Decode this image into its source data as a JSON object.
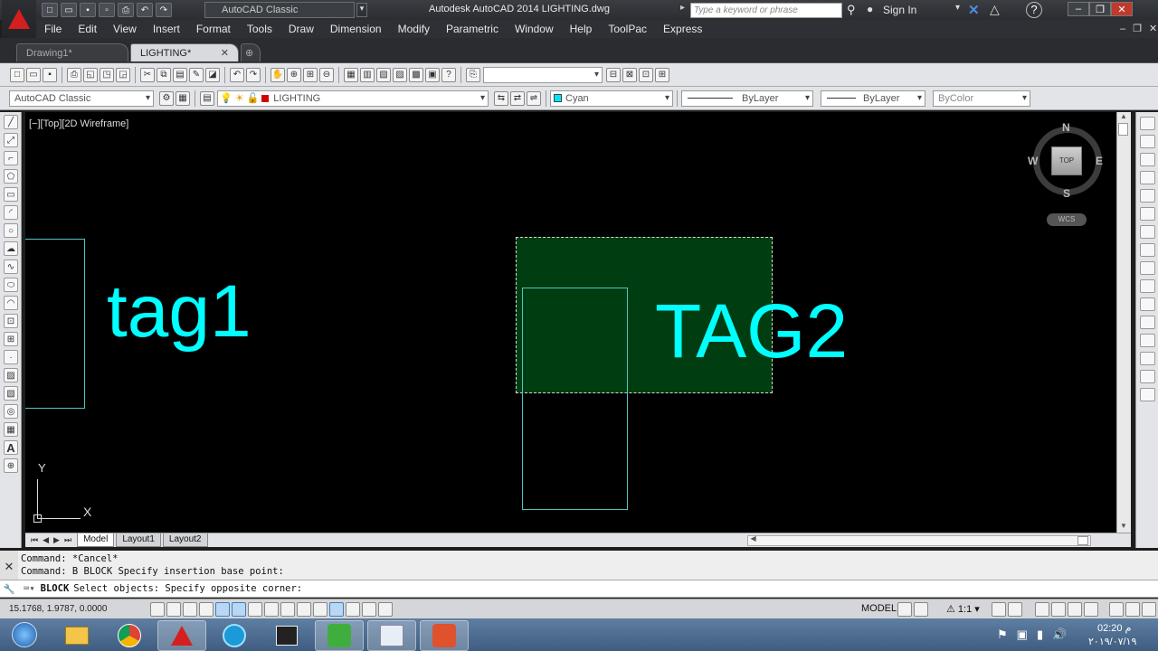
{
  "title_bar": {
    "workspace": "AutoCAD Classic",
    "app_title": "Autodesk AutoCAD 2014    LIGHTING.dwg",
    "search_placeholder": "Type a keyword or phrase",
    "sign_in": "Sign In"
  },
  "menu": {
    "items": [
      "File",
      "Edit",
      "View",
      "Insert",
      "Format",
      "Tools",
      "Draw",
      "Dimension",
      "Modify",
      "Parametric",
      "Window",
      "Help",
      "ToolPac",
      "Express"
    ]
  },
  "doc_tabs": [
    {
      "label": "Drawing1*",
      "active": false
    },
    {
      "label": "LIGHTING*",
      "active": true
    }
  ],
  "toolbar2": {
    "workspace_combo": "AutoCAD Classic",
    "layer_combo": "LIGHTING",
    "color_combo": "Cyan",
    "linetype_combo": "ByLayer",
    "lineweight_combo": "ByLayer",
    "plotstyle_combo": "ByColor"
  },
  "canvas": {
    "viewport_label": "[−][Top][2D Wireframe]",
    "text_objects": [
      "tag1",
      "TAG2"
    ],
    "viewcube": {
      "north": "N",
      "south": "S",
      "east": "E",
      "west": "W",
      "face": "TOP",
      "wcs": "WCS"
    },
    "ucs": {
      "x": "X",
      "y": "Y"
    },
    "entity_color": "#00ffff",
    "selection_fill": "#003d10"
  },
  "layout_tabs": [
    "Model",
    "Layout1",
    "Layout2"
  ],
  "command": {
    "history": [
      "Command: *Cancel*",
      "Command: B BLOCK Specify insertion base point:"
    ],
    "prompt_keyword": "BLOCK",
    "prompt_text": "Select objects: Specify opposite corner:"
  },
  "status": {
    "coords": "15.1768, 1.9787, 0.0000",
    "model": "MODEL",
    "scale": "1:1"
  },
  "taskbar": {
    "time": "02:20 م",
    "date": "٢٠١٩/٠٧/١٩"
  }
}
